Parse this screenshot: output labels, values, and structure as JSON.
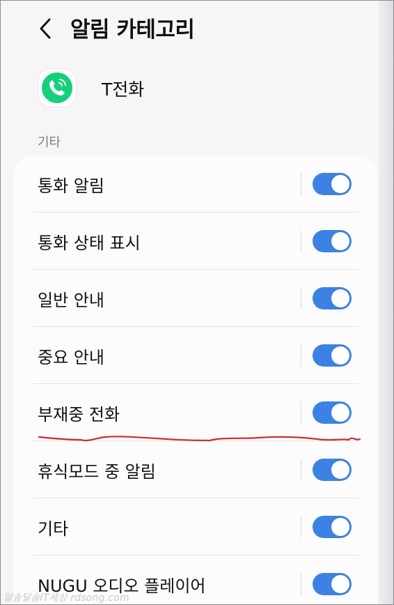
{
  "header": {
    "title": "알림 카테고리",
    "back_icon": "chevron-left-icon"
  },
  "app": {
    "name": "T전화",
    "icon": "phone-icon",
    "icon_color": "#14d07a"
  },
  "section": {
    "label": "기타"
  },
  "settings": [
    {
      "label": "통화 알림",
      "enabled": true
    },
    {
      "label": "통화 상태 표시",
      "enabled": true
    },
    {
      "label": "일반 안내",
      "enabled": true
    },
    {
      "label": "중요 안내",
      "enabled": true
    },
    {
      "label": "부재중 전화",
      "enabled": true
    },
    {
      "label": "휴식모드 중 알림",
      "enabled": true
    },
    {
      "label": "기타",
      "enabled": true
    },
    {
      "label": "NUGU 오디오 플레이어",
      "enabled": true
    }
  ],
  "colors": {
    "toggle_on": "#3b82e4",
    "annotation": "#d42a2a"
  },
  "watermark": "알송달송IT세상 rdsong.com"
}
